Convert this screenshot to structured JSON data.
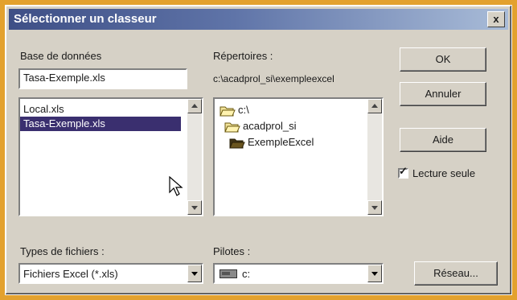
{
  "window": {
    "title": "Sélectionner un classeur",
    "close_label": "x"
  },
  "database": {
    "label": "Base de données",
    "value": "Tasa-Exemple.xls",
    "files": [
      {
        "name": "Local.xls",
        "selected": false
      },
      {
        "name": "Tasa-Exemple.xls",
        "selected": true
      }
    ]
  },
  "directories": {
    "label": "Répertoires :",
    "current_path": "c:\\acadprol_si\\exempleexcel",
    "tree": [
      {
        "name": "c:\\",
        "icon": "open-folder-icon"
      },
      {
        "name": "acadprol_si",
        "icon": "open-folder-icon"
      },
      {
        "name": "ExempleExcel",
        "icon": "open-folder-icon"
      }
    ]
  },
  "buttons": {
    "ok": "OK",
    "cancel": "Annuler",
    "help": "Aide",
    "network": "Réseau..."
  },
  "read_only": {
    "label": "Lecture seule",
    "checked": true,
    "mark": "✓"
  },
  "file_types": {
    "label": "Types de fichiers :",
    "value": "Fichiers Excel (*.xls)"
  },
  "drives": {
    "label": "Pilotes :",
    "value": "c:",
    "icon": "drive-icon"
  },
  "colors": {
    "selection": "#3a2f6f",
    "dialog_bg": "#d6d1c6",
    "frame": "#e3a12e"
  }
}
